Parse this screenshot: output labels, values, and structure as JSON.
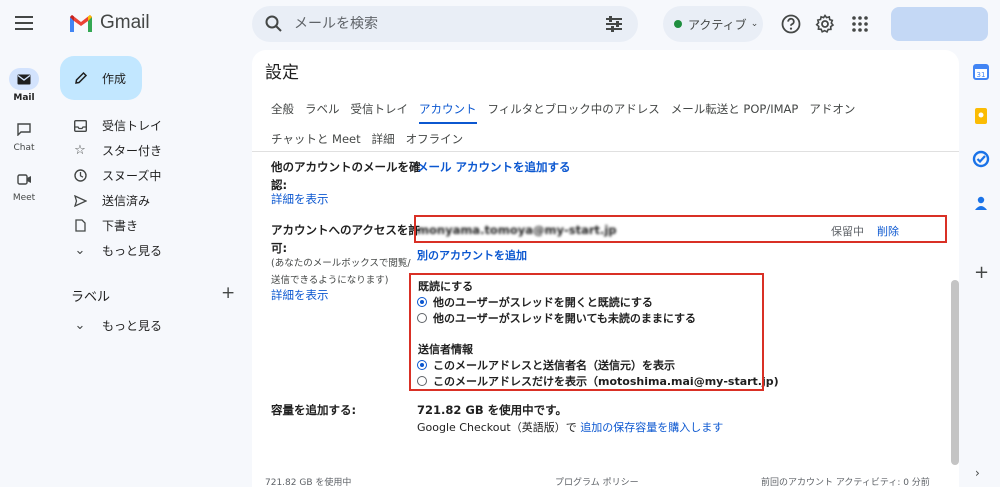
{
  "app": {
    "name": "Gmail"
  },
  "search": {
    "placeholder": "メールを検索"
  },
  "status": {
    "label": "アクティブ",
    "color": "#1e8e3e"
  },
  "rail": [
    {
      "label": "Mail"
    },
    {
      "label": "Chat"
    },
    {
      "label": "Meet"
    }
  ],
  "compose": {
    "label": "作成"
  },
  "nav": [
    {
      "label": "受信トレイ",
      "icon": "inbox-icon"
    },
    {
      "label": "スター付き",
      "icon": "star-icon"
    },
    {
      "label": "スヌーズ中",
      "icon": "clock-icon"
    },
    {
      "label": "送信済み",
      "icon": "send-icon"
    },
    {
      "label": "下書き",
      "icon": "draft-icon"
    },
    {
      "label": "もっと見る",
      "icon": "chevron-down-icon"
    }
  ],
  "labels": {
    "title": "ラベル",
    "more": "もっと見る"
  },
  "settings": {
    "title": "設定",
    "tabs_row1": [
      "全般",
      "ラベル",
      "受信トレイ",
      "アカウント",
      "フィルタとブロック中のアドレス",
      "メール転送と POP/IMAP",
      "アドオン"
    ],
    "tabs_row2": [
      "チャットと Meet",
      "詳細",
      "オフライン"
    ],
    "active_tab": "アカウント",
    "other_accounts": {
      "label_line1": "他のアカウントのメールを確",
      "label_line2": "認:",
      "details": "詳細を表示",
      "action": "メール アカウントを追加する"
    },
    "grant_access": {
      "label_line1": "アカウントへのアクセスを許",
      "label_line2": "可:",
      "note_line1": "(あなたのメールボックスで閲覧/",
      "note_line2": "送信できるようになります)",
      "details": "詳細を表示",
      "email": "monyama.tomoya@my-start.jp",
      "status": "保留中",
      "delete": "削除",
      "add_another": "別のアカウントを追加"
    },
    "read_mark": {
      "heading": "既読にする",
      "option1": "他のユーザーがスレッドを開くと既読にする",
      "option2": "他のユーザーがスレッドを開いても未読のままにする",
      "selected": 1
    },
    "sender_info": {
      "heading": "送信者情報",
      "option1": "このメールアドレスと送信者名（送信元）を表示",
      "option2": "このメールアドレスだけを表示（motoshima.mai@my-start.jp)",
      "selected": 1
    },
    "storage": {
      "label": "容量を追加する:",
      "usage": "721.82 GB を使用中です。",
      "checkout_text": "Google Checkout（英語版）で",
      "purchase_link": "追加の保存容量を購入します"
    },
    "footer": {
      "usage": "721.82 GB を使用中",
      "policy": "プログラム ポリシー",
      "activity": "前回のアカウント アクティビティ: 0 分前"
    }
  },
  "colors": {
    "accent": "#0b57d0",
    "highlight": "#d93025"
  }
}
